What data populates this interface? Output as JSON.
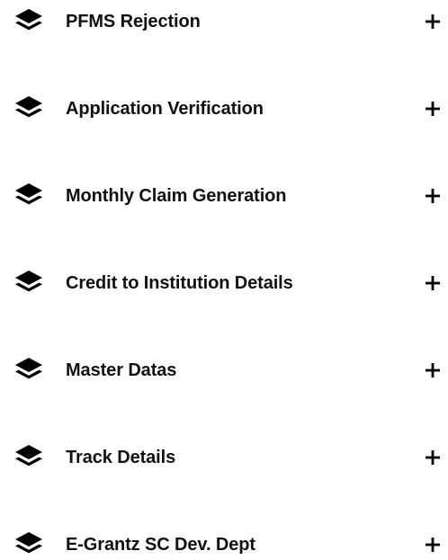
{
  "colors": {
    "text": "#111111",
    "icon": "#000000",
    "background": "#ffffff"
  },
  "menu": {
    "items": [
      {
        "label": "PFMS Rejection",
        "icon": "layers-icon",
        "toggle": "plus-icon"
      },
      {
        "label": "Application Verification",
        "icon": "layers-icon",
        "toggle": "plus-icon"
      },
      {
        "label": "Monthly Claim Generation",
        "icon": "layers-icon",
        "toggle": "plus-icon"
      },
      {
        "label": "Credit to Institution Details",
        "icon": "layers-icon",
        "toggle": "plus-icon"
      },
      {
        "label": "Master Datas",
        "icon": "layers-icon",
        "toggle": "plus-icon"
      },
      {
        "label": "Track Details",
        "icon": "layers-icon",
        "toggle": "plus-icon"
      },
      {
        "label": "E-Grantz SC Dev. Dept",
        "icon": "layers-icon",
        "toggle": "plus-icon"
      }
    ]
  }
}
